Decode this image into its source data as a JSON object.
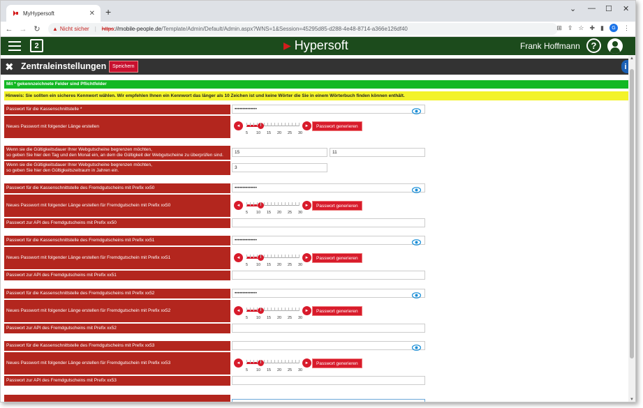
{
  "browser": {
    "tab_title": "MyHypersoft",
    "tab_close": "✕",
    "new_tab": "+",
    "win_min": "—",
    "win_max": "☐",
    "win_close": "✕",
    "win_menu": "⌄",
    "back": "←",
    "forward": "→",
    "reload": "↻",
    "not_secure": "Nicht sicher",
    "url_scheme": "https",
    "url_host": "://mobile-people.de",
    "url_path": "/Template/Admin/Default/Admin.aspx?WNS=1&Session=45295d85-d288-4e48-8714-a366e126df40",
    "profile_letter": "G"
  },
  "app": {
    "brand": "Hypersoft",
    "doc_icon_label": "2",
    "user_name": "Frank Hoffmann",
    "help_label": "?"
  },
  "page": {
    "title": "Zentraleinstellungen",
    "save_label": "Speichern",
    "info_label": "i",
    "required_note": "Mit * gekennzeichnete Felder sind Pflichtfelder",
    "hint": "Hinweis: Sie sollten ein sicheres Kennwort wählen. Wir empfehlen Ihnen ein Kennwort das länger als 10 Zeichen ist und keine Wörter die Sie in einem Wörterbuch finden können enthält."
  },
  "slider": {
    "tick_labels": [
      "5",
      "10",
      "15",
      "20",
      "25",
      "30"
    ],
    "value": 10,
    "min": 5,
    "max": 30,
    "generate_label": "Passwort generieren",
    "left_arrow": "◄",
    "right_arrow": "►"
  },
  "main": {
    "pw_label": "Passwort für die Kassenschnittstelle *",
    "pw_value": "••••••••••••••",
    "gen_label": "Neues Passwort mit folgender Länge erstellen",
    "validity_label_1": "Wenn sie die Gültigkeitsdauer Ihrer Webgutscheine begrenzen möchten,",
    "validity_label_2": "so geben Sie hier den Tag und den Monat ein, an dem die Gültigkeit der Webgutscheine zu überprüfen sind.",
    "validity_day": "15",
    "validity_month": "11",
    "years_label_1": "Wenn sie die Gültigkeitsdauer Ihrer Webgutscheine begrenzen möchten,",
    "years_label_2": "so geben Sie hier den Gültigkeitszeitraum in Jahren ein.",
    "years_value": "3"
  },
  "prefix_groups": [
    {
      "pw_label": "Passwort für die Kassenschnittstelle des Fremdgutscheins mit Prefix xx50",
      "pw_value": "••••••••••••••",
      "gen_label": "Neues Passwort mit folgender Länge erstellen für Fremdgutschein mit Prefix xx50",
      "api_label": "Passwort zur API des Fremdgutscheins mit Prefix xx50",
      "api_value": ""
    },
    {
      "pw_label": "Passwort für die Kassenschnittstelle des Fremdgutscheins mit Prefix xx51",
      "pw_value": "••••••••••••••",
      "gen_label": "Neues Passwort mit folgender Länge erstellen für Fremdgutschein mit Prefix xx51",
      "api_label": "Passwort zur API des Fremdgutscheins mit Prefix xx51",
      "api_value": ""
    },
    {
      "pw_label": "Passwort für die Kassenschnittstelle des Fremdgutscheins mit Prefix xx52",
      "pw_value": "••••••••••••••",
      "gen_label": "Neues Passwort mit folgender Länge erstellen für Fremdgutschein mit Prefix xx52",
      "api_label": "Passwort zur API des Fremdgutscheins mit Prefix xx52",
      "api_value": ""
    },
    {
      "pw_label": "Passwort für die Kassenschnittstelle des Fremdgutscheins mit Prefix xx53",
      "pw_value": "",
      "gen_label": "Neues Passwort mit folgender Länge erstellen für Fremdgutschein mit Prefix xx53",
      "api_label": "Passwort zur API des Fremdgutscheins mit Prefix xx53",
      "api_value": ""
    }
  ],
  "colors": {
    "header_green": "#1c4b1c",
    "label_red": "#b3261e",
    "button_red": "#d81b2b",
    "required_green": "#13b824",
    "hint_yellow": "#f3f32a"
  }
}
